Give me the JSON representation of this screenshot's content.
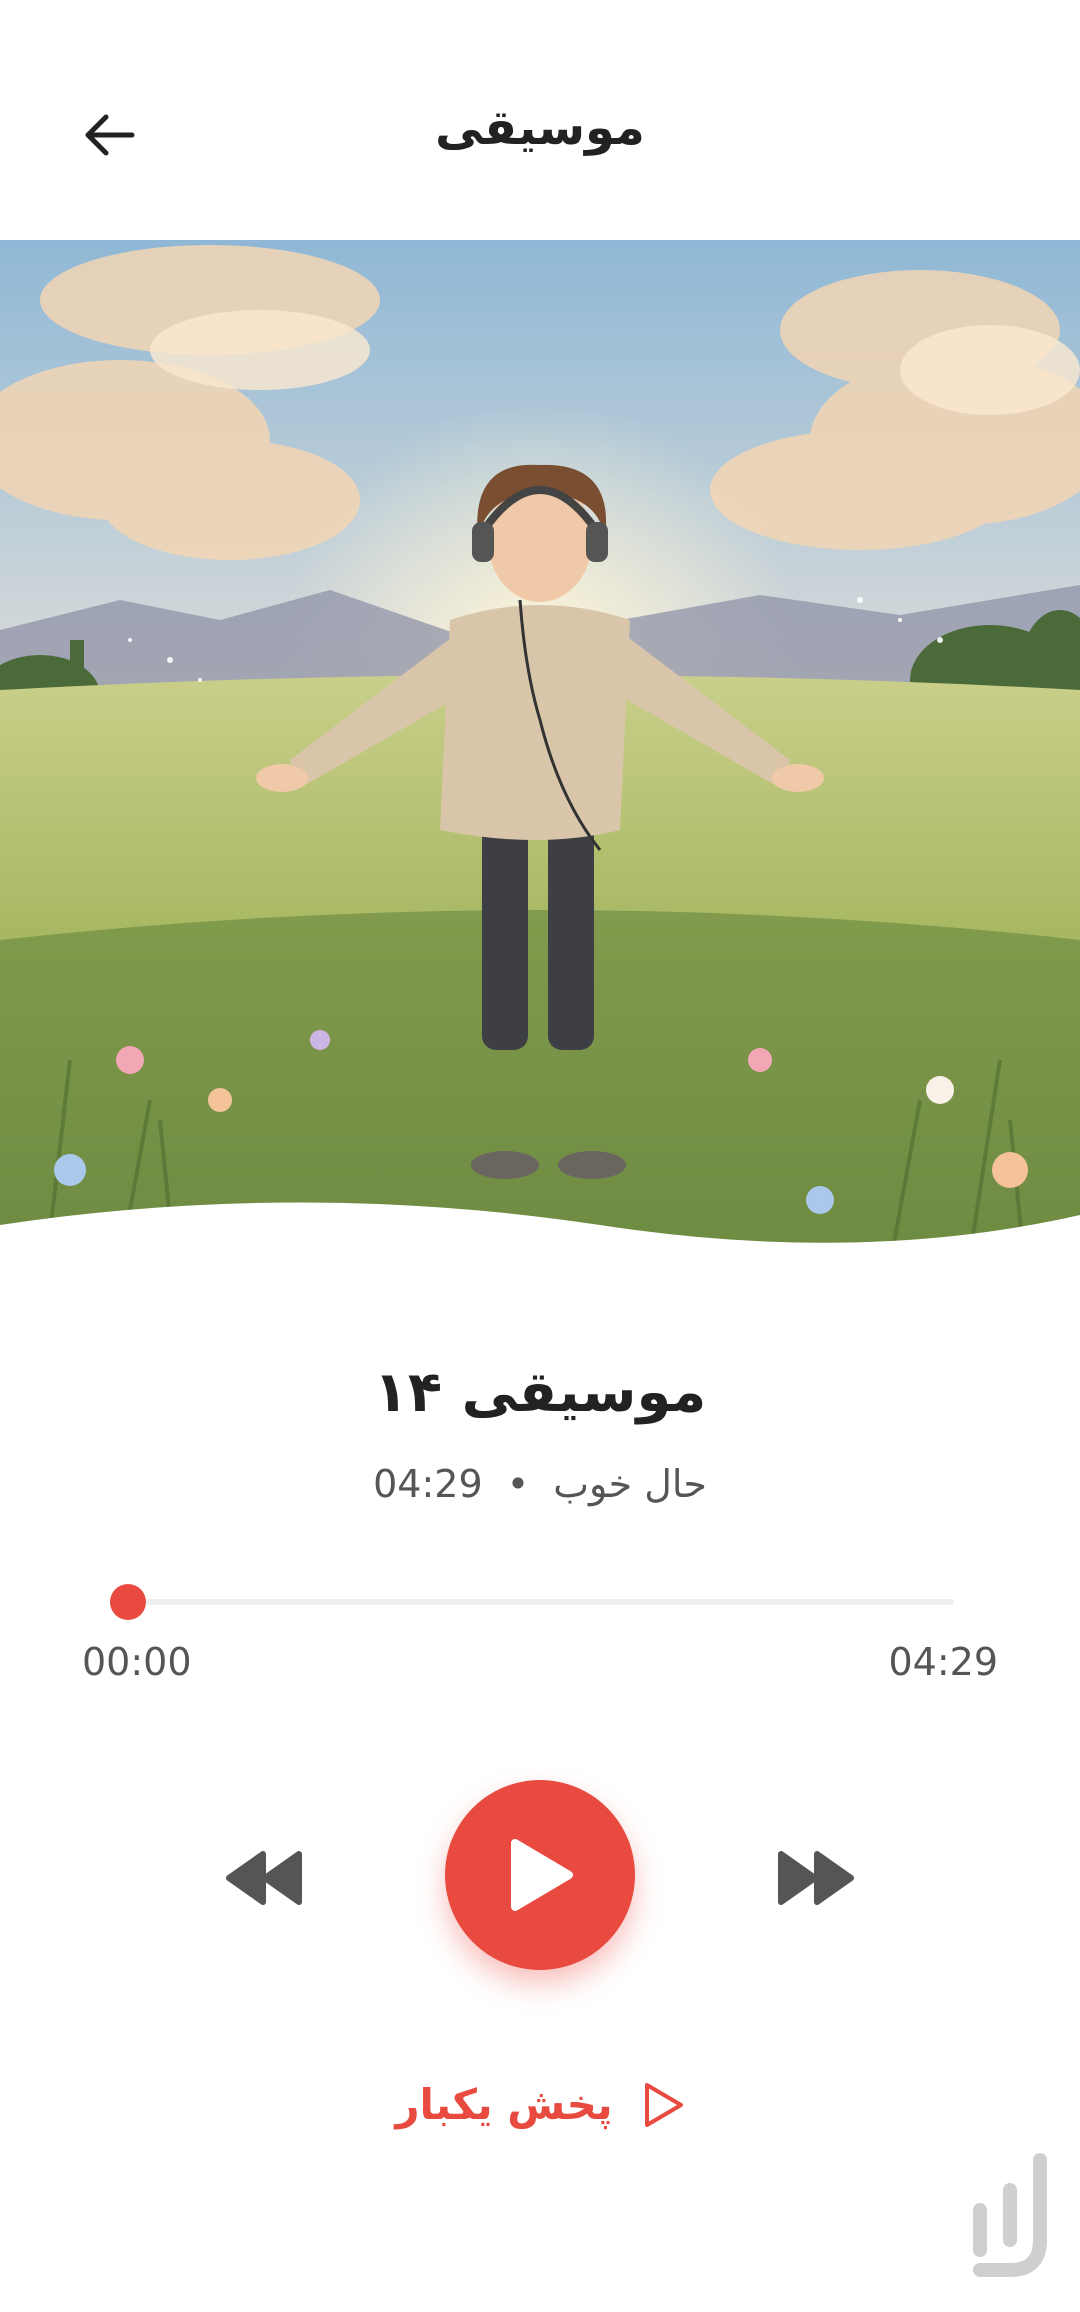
{
  "header": {
    "title": "موسیقی",
    "back_icon": "arrow-left-icon"
  },
  "artwork": {
    "description_icon": "album-artwork-image"
  },
  "track": {
    "title": "موسیقی ۱۴",
    "category": "حال خوب",
    "separator": "•",
    "duration": "04:29"
  },
  "progress": {
    "elapsed": "00:00",
    "total": "04:29",
    "fraction": 0.0
  },
  "controls": {
    "rewind_icon": "rewind-icon",
    "play_icon": "play-icon",
    "forward_icon": "fast-forward-icon"
  },
  "play_once": {
    "label": "پخش یکبار",
    "icon": "play-outline-icon"
  },
  "colors": {
    "accent": "#e84a3f",
    "text": "#222222",
    "muted": "#555555",
    "track_bg": "#eeeeee"
  }
}
